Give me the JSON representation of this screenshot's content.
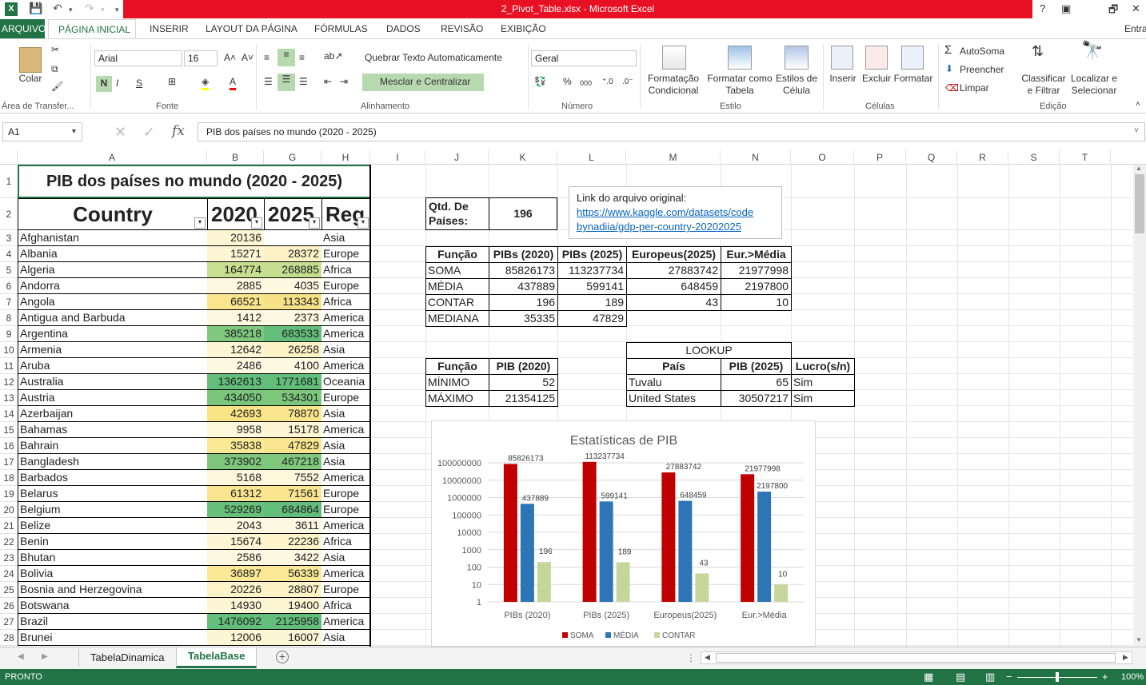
{
  "window": {
    "title": "2_Pivot_Table.xlsx - Microsoft Excel",
    "controls": [
      "?",
      "▣",
      "🗗",
      "✕"
    ]
  },
  "ribbon_tabs": [
    "ARQUIVO",
    "PÁGINA INICIAL",
    "INSERIR",
    "LAYOUT DA PÁGINA",
    "FÓRMULAS",
    "DADOS",
    "REVISÃO",
    "EXIBIÇÃO"
  ],
  "signin": "Entra",
  "ribbon": {
    "clipboard": {
      "paste": "Colar",
      "label": "Área de Transfer..."
    },
    "font": {
      "name": "Arial",
      "size": "16",
      "bold": "N",
      "italic": "I",
      "underline": "S",
      "label": "Fonte"
    },
    "alignment": {
      "wrap": "Quebrar Texto Automaticamente",
      "merge": "Mesclar e Centralizar",
      "label": "Alinhamento"
    },
    "number": {
      "format": "Geral",
      "label": "Número",
      "pct": "%",
      "thousands": "000"
    },
    "styles": {
      "cond": "Formatação Condicional",
      "table": "Formatar como Tabela",
      "cell": "Estilos de Célula",
      "label": "Estilo"
    },
    "cells": {
      "insert": "Inserir",
      "delete": "Excluir",
      "format": "Formatar",
      "label": "Células"
    },
    "editing": {
      "autosum": "AutoSoma",
      "fill": "Preencher",
      "clear": "Limpar",
      "sort": "Classificar e Filtrar",
      "find": "Localizar e Selecionar",
      "label": "Edição"
    }
  },
  "formula_bar": {
    "namebox": "A1",
    "fx": "fx",
    "content": "PIB dos países no mundo (2020 - 2025)"
  },
  "columns": [
    "A",
    "B",
    "G",
    "H",
    "I",
    "J",
    "K",
    "L",
    "M",
    "N",
    "O",
    "P",
    "Q",
    "R",
    "S",
    "T"
  ],
  "rows": [
    "1",
    "2",
    "3",
    "4",
    "5",
    "6",
    "7",
    "8",
    "9",
    "10",
    "11",
    "12",
    "13",
    "14",
    "15",
    "16",
    "17",
    "18",
    "19",
    "20",
    "21",
    "22",
    "23",
    "24",
    "25",
    "26",
    "27",
    "28"
  ],
  "table": {
    "title": "PIB dos países no mundo (2020 - 2025)",
    "headers": [
      "Country",
      "2020",
      "2025",
      "Reg"
    ],
    "data": [
      [
        "Afghanistan",
        "20136",
        "",
        "Asia"
      ],
      [
        "Albania",
        "15271",
        "28372",
        "Europe"
      ],
      [
        "Algeria",
        "164774",
        "268885",
        "Africa"
      ],
      [
        "Andorra",
        "2885",
        "4035",
        "Europe"
      ],
      [
        "Angola",
        "66521",
        "113343",
        "Africa"
      ],
      [
        "Antigua and Barbuda",
        "1412",
        "2373",
        "America"
      ],
      [
        "Argentina",
        "385218",
        "683533",
        "America"
      ],
      [
        "Armenia",
        "12642",
        "26258",
        "Asia"
      ],
      [
        "Aruba",
        "2486",
        "4100",
        "America"
      ],
      [
        "Australia",
        "1362613",
        "1771681",
        "Oceania"
      ],
      [
        "Austria",
        "434050",
        "534301",
        "Europe"
      ],
      [
        "Azerbaijan",
        "42693",
        "78870",
        "Asia"
      ],
      [
        "Bahamas",
        "9958",
        "15178",
        "America"
      ],
      [
        "Bahrain",
        "35838",
        "47829",
        "Asia"
      ],
      [
        "Bangladesh",
        "373902",
        "467218",
        "Asia"
      ],
      [
        "Barbados",
        "5168",
        "7552",
        "America"
      ],
      [
        "Belarus",
        "61312",
        "71561",
        "Europe"
      ],
      [
        "Belgium",
        "529269",
        "684864",
        "Europe"
      ],
      [
        "Belize",
        "2043",
        "3611",
        "America"
      ],
      [
        "Benin",
        "15674",
        "22236",
        "Africa"
      ],
      [
        "Bhutan",
        "2586",
        "3422",
        "Asia"
      ],
      [
        "Bolivia",
        "36897",
        "56339",
        "America"
      ],
      [
        "Bosnia and Herzegovina",
        "20226",
        "28807",
        "Europe"
      ],
      [
        "Botswana",
        "14930",
        "19400",
        "Africa"
      ],
      [
        "Brazil",
        "1476092",
        "2125958",
        "America"
      ],
      [
        "Brunei",
        "12006",
        "16007",
        "Asia"
      ]
    ],
    "colors_b": [
      "#fdf5d3",
      "#fdf5d3",
      "#c7df8e",
      "#fdf8e0",
      "#f9e58d",
      "#fdf8e0",
      "#7fc87e",
      "#fdf5d3",
      "#fdf8e0",
      "#63be7b",
      "#7ac67c",
      "#f9e486",
      "#fdf7db",
      "#fae995",
      "#7ec77c",
      "#fdf7dd",
      "#f9e58f",
      "#68c07b",
      "#fdf8e0",
      "#fdf5d3",
      "#fdf8e0",
      "#fae895",
      "#fcf3c9",
      "#fdf5d4",
      "#63be7b",
      "#fdf6d5"
    ],
    "colors_g": [
      "#ffffff",
      "#fcf2c6",
      "#c5de8f",
      "#fdf8e0",
      "#f6e188",
      "#fdf8e1",
      "#63be7b",
      "#fcf2c5",
      "#fdf8e0",
      "#63be7b",
      "#7dc77c",
      "#f9e58c",
      "#fdf5d3",
      "#f9e58f",
      "#7fc87e",
      "#fdf7dc",
      "#f9e68f",
      "#63be7b",
      "#fdf8e1",
      "#fcf3c9",
      "#fdf8e1",
      "#fae896",
      "#fcf2c5",
      "#fdf5d1",
      "#63be7b",
      "#fdf6d6"
    ]
  },
  "qtd": {
    "label": "Qtd. De Países:",
    "value": "196"
  },
  "link": {
    "label": "Link do arquivo original:",
    "url1": "https://www.kaggle.com/datasets/code",
    "url2": "bynadiia/gdp-per-country-20202025"
  },
  "stats": {
    "headers": [
      "Função",
      "PIBs (2020)",
      "PIBs (2025)",
      "Europeus(2025)",
      "Eur.>Média"
    ],
    "rows": [
      [
        "SOMA",
        "85826173",
        "113237734",
        "27883742",
        "21977998"
      ],
      [
        "MÉDIA",
        "437889",
        "599141",
        "648459",
        "2197800"
      ],
      [
        "CONTAR",
        "196",
        "189",
        "43",
        "10"
      ],
      [
        "MEDIANA",
        "35335",
        "47829",
        "",
        ""
      ]
    ]
  },
  "minmax": {
    "headers": [
      "Função",
      "PIB (2020)"
    ],
    "rows": [
      [
        "MÍNIMO",
        "52"
      ],
      [
        "MÁXIMO",
        "21354125"
      ]
    ]
  },
  "lookup": {
    "title": "LOOKUP",
    "headers": [
      "País",
      "PIB (2025)",
      "Lucro(s/n)"
    ],
    "rows": [
      [
        "Tuvalu",
        "65",
        "Sim"
      ],
      [
        "United States",
        "30507217",
        "Sim"
      ]
    ]
  },
  "chart_data": {
    "type": "bar",
    "title": "Estatísticas de PIB",
    "categories": [
      "PIBs (2020)",
      "PIBs (2025)",
      "Europeus(2025)",
      "Eur.>Média"
    ],
    "series": [
      {
        "name": "SOMA",
        "values": [
          85826173,
          113237734,
          27883742,
          21977998
        ],
        "color": "#c00000"
      },
      {
        "name": "MÉDIA",
        "values": [
          437889,
          599141,
          648459,
          2197800
        ],
        "color": "#2e75b6"
      },
      {
        "name": "CONTAR",
        "values": [
          196,
          189,
          43,
          10
        ],
        "color": "#c5d69b"
      }
    ],
    "yscale": "log",
    "ylim": [
      1,
      100000000
    ],
    "yticks": [
      "100000000",
      "10000000",
      "1000000",
      "100000",
      "10000",
      "1000",
      "100",
      "10",
      "1"
    ],
    "legend": "bottom",
    "grid": true
  },
  "sheets": [
    "TabelaDinamica",
    "TabelaBase"
  ],
  "active_sheet": "TabelaBase",
  "status": {
    "mode": "PRONTO",
    "zoom": "100%"
  }
}
